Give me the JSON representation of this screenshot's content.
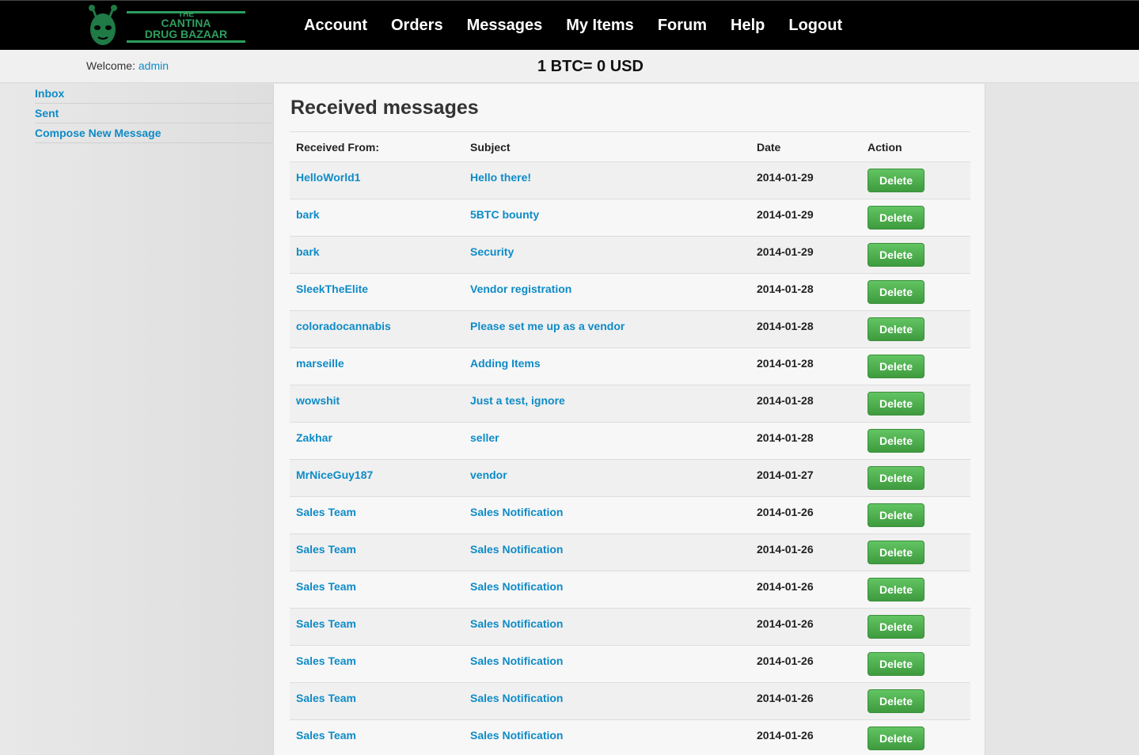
{
  "header": {
    "logo_lines": [
      "THE",
      "CANTINA",
      "DRUG BAZAAR"
    ],
    "nav": [
      {
        "label": "Account"
      },
      {
        "label": "Orders"
      },
      {
        "label": "Messages"
      },
      {
        "label": "My Items"
      },
      {
        "label": "Forum"
      },
      {
        "label": "Help"
      },
      {
        "label": "Logout"
      }
    ]
  },
  "subbar": {
    "welcome_label": "Welcome:",
    "username": "admin",
    "btc_rate": "1 BTC= 0 USD"
  },
  "sidebar": {
    "items": [
      {
        "label": "Inbox"
      },
      {
        "label": "Sent"
      },
      {
        "label": "Compose New Message"
      }
    ]
  },
  "main": {
    "title": "Received messages",
    "columns": [
      "Received From:",
      "Subject",
      "Date",
      "Action"
    ],
    "delete_label": "Delete",
    "rows": [
      {
        "from": "HelloWorld1",
        "subject": "Hello there!",
        "date": "2014-01-29"
      },
      {
        "from": "bark",
        "subject": "5BTC bounty",
        "date": "2014-01-29"
      },
      {
        "from": "bark",
        "subject": "Security",
        "date": "2014-01-29"
      },
      {
        "from": "SleekTheElite",
        "subject": "Vendor registration",
        "date": "2014-01-28"
      },
      {
        "from": "coloradocannabis",
        "subject": "Please set me up as a vendor",
        "date": "2014-01-28"
      },
      {
        "from": "marseille",
        "subject": "Adding Items",
        "date": "2014-01-28"
      },
      {
        "from": "wowshit",
        "subject": "Just a test, ignore",
        "date": "2014-01-28"
      },
      {
        "from": "Zakhar",
        "subject": "seller",
        "date": "2014-01-28"
      },
      {
        "from": "MrNiceGuy187",
        "subject": "vendor",
        "date": "2014-01-27"
      },
      {
        "from": "Sales Team",
        "subject": "Sales Notification",
        "date": "2014-01-26"
      },
      {
        "from": "Sales Team",
        "subject": "Sales Notification",
        "date": "2014-01-26"
      },
      {
        "from": "Sales Team",
        "subject": "Sales Notification",
        "date": "2014-01-26"
      },
      {
        "from": "Sales Team",
        "subject": "Sales Notification",
        "date": "2014-01-26"
      },
      {
        "from": "Sales Team",
        "subject": "Sales Notification",
        "date": "2014-01-26"
      },
      {
        "from": "Sales Team",
        "subject": "Sales Notification",
        "date": "2014-01-26"
      },
      {
        "from": "Sales Team",
        "subject": "Sales Notification",
        "date": "2014-01-26"
      }
    ]
  },
  "colors": {
    "link": "#0e8bc7",
    "brand_green": "#2e9e5e",
    "button_green": "#4fae4f"
  }
}
